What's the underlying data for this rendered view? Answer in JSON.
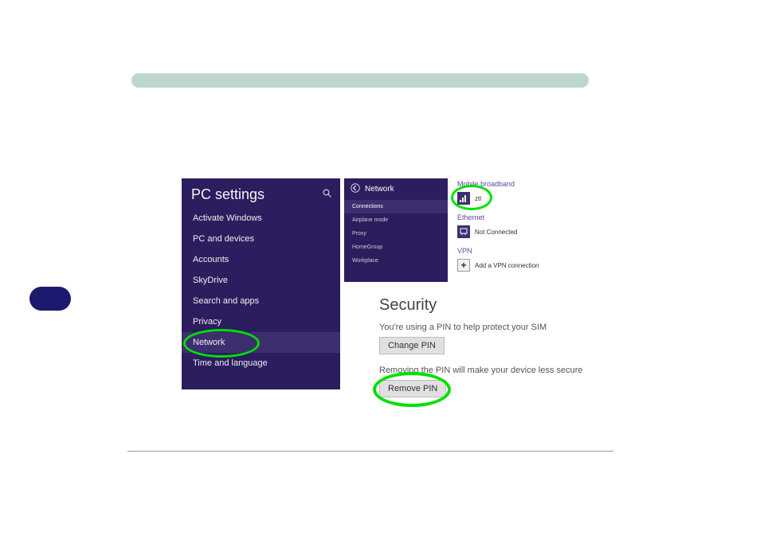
{
  "pcSettings": {
    "title": "PC settings",
    "items": [
      "Activate Windows",
      "PC and devices",
      "Accounts",
      "SkyDrive",
      "Search and apps",
      "Privacy",
      "Network",
      "Time and language"
    ]
  },
  "networkPanel": {
    "title": "Network",
    "items": [
      "Connections",
      "Airplane mode",
      "Proxy",
      "HomeGroup",
      "Workplace"
    ]
  },
  "connections": {
    "mobile": {
      "label": "Mobile broadband",
      "name": "ztl"
    },
    "ethernet": {
      "label": "Ethernet",
      "status": "Not Connected"
    },
    "vpn": {
      "label": "VPN",
      "add": "Add a VPN connection"
    }
  },
  "security": {
    "heading": "Security",
    "usingPin": "You're using a PIN to help protect your SIM",
    "changeBtn": "Change PIN",
    "removeWarn": "Removing the PIN will make your device less secure",
    "removeBtn": "Remove PIN"
  }
}
